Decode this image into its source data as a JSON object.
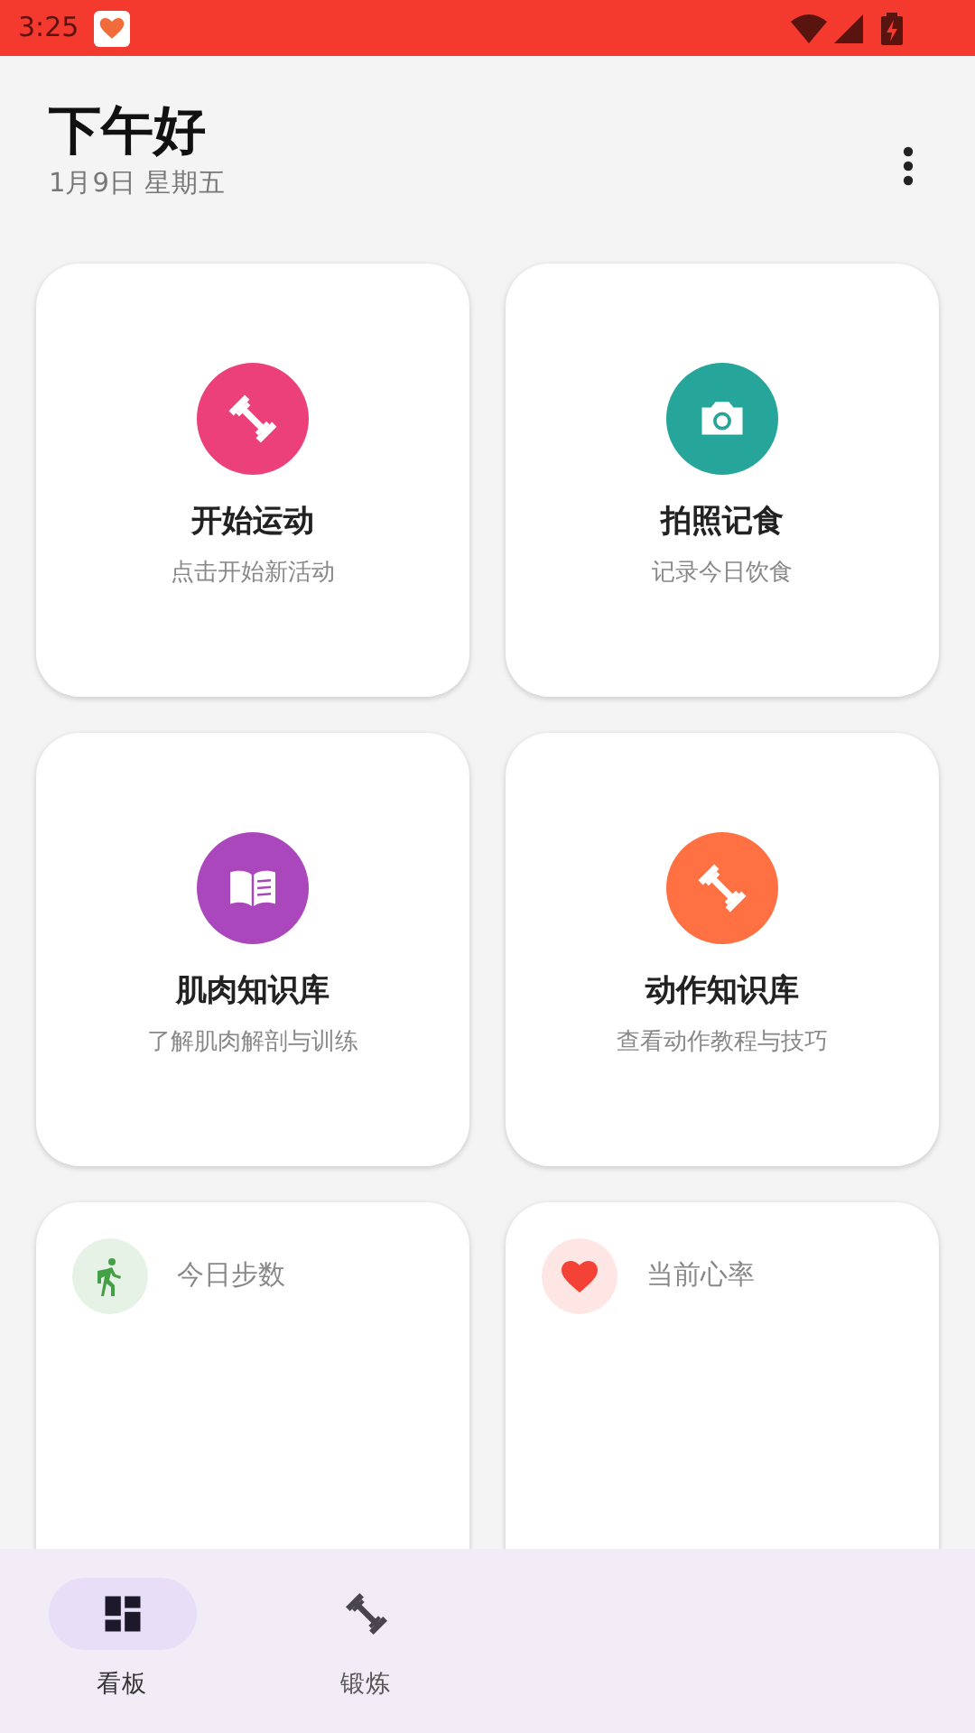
{
  "status_bar": {
    "time": "3:25"
  },
  "header": {
    "greeting": "下午好",
    "date": "1月9日 星期五"
  },
  "action_cards": [
    {
      "kind": "dumbbell",
      "color": "#ec407a",
      "title": "开始运动",
      "subtitle": "点击开始新活动"
    },
    {
      "kind": "camera",
      "color": "#26a69a",
      "title": "拍照记食",
      "subtitle": "记录今日饮食"
    },
    {
      "kind": "book",
      "color": "#ab47bc",
      "title": "肌肉知识库",
      "subtitle": "了解肌肉解剖与训练"
    },
    {
      "kind": "dumbbell",
      "color": "#ff7043",
      "title": "动作知识库",
      "subtitle": "查看动作教程与技巧"
    }
  ],
  "stat_cards": [
    {
      "kind": "walk",
      "color": "#43a047",
      "label": "今日步数"
    },
    {
      "kind": "heart",
      "color": "#f44336",
      "label": "当前心率"
    }
  ],
  "bottom_nav": [
    {
      "kind": "dashboard",
      "label": "看板",
      "selected": true
    },
    {
      "kind": "dumbbell",
      "label": "锻炼",
      "selected": false
    }
  ]
}
